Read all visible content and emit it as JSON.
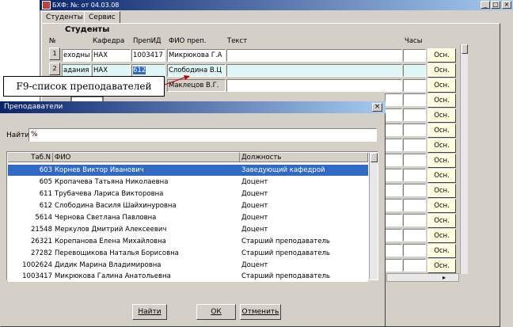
{
  "window": {
    "title": "БХФ: №: от 04.03.08"
  },
  "tabs": [
    {
      "label": "Студенты"
    },
    {
      "label": "Сервис"
    }
  ],
  "block": {
    "title": "Студенты",
    "headers": {
      "num": "№",
      "kafedra": "Кафедра",
      "prepid": "ПрепИД",
      "fio": "ФИО преп.",
      "text": "Текст",
      "hours": "Часы"
    },
    "rows": [
      {
        "num": "1",
        "left": "еходны",
        "kafedra": "НАХ",
        "prepid": "1003417",
        "fio": "Микрюкова Г.А",
        "osn": "Осн."
      },
      {
        "num": "2",
        "left": "адания",
        "kafedra": "НАХ",
        "prepid": "612",
        "fio": "Слободина В.Ц",
        "osn": "Осн."
      },
      {
        "num": "",
        "left": "",
        "kafedra": "",
        "prepid": "",
        "fio": "Маклецов В.Г.",
        "osn": "Осн."
      },
      {
        "num": "",
        "left": "",
        "kafedra": "",
        "prepid": "",
        "fio": "",
        "osn": "Осн."
      },
      {
        "num": "",
        "left": "",
        "kafedra": "",
        "prepid": "",
        "fio": "",
        "osn": "Осн."
      },
      {
        "num": "",
        "left": "",
        "kafedra": "",
        "prepid": "",
        "fio": "",
        "osn": "Осн."
      },
      {
        "num": "",
        "left": "",
        "kafedra": "",
        "prepid": "",
        "fio": "",
        "osn": "Осн."
      },
      {
        "num": "",
        "left": "",
        "kafedra": "",
        "prepid": "",
        "fio": "",
        "osn": "Осн."
      },
      {
        "num": "",
        "left": "",
        "kafedra": "",
        "prepid": "",
        "fio": "",
        "osn": "Осн."
      },
      {
        "num": "",
        "left": "",
        "kafedra": "",
        "prepid": "",
        "fio": "",
        "osn": "Осн."
      },
      {
        "num": "",
        "left": "",
        "kafedra": "",
        "prepid": "",
        "fio": "",
        "osn": "Осн."
      },
      {
        "num": "",
        "left": "",
        "kafedra": "",
        "prepid": "",
        "fio": "",
        "osn": "Осн."
      },
      {
        "num": "",
        "left": "",
        "kafedra": "",
        "prepid": "",
        "fio": "",
        "osn": "Осн."
      },
      {
        "num": "",
        "left": "",
        "kafedra": "",
        "prepid": "",
        "fio": "",
        "osn": "Осн."
      },
      {
        "num": "",
        "left": "",
        "kafedra": "",
        "prepid": "",
        "fio": "",
        "osn": "Осн."
      }
    ]
  },
  "callout": {
    "text": "F9-список преподавателей"
  },
  "dialog": {
    "title": "Преподаватели",
    "close_glyph": "×",
    "find_label": "Найти",
    "find_value": "%",
    "columns": {
      "tab": "Таб.N",
      "fio": "ФИО",
      "position": "Должность"
    },
    "rows": [
      {
        "tab": "603",
        "fio": "Корнев Виктор Иванович",
        "position": "Заведующий кафедрой",
        "selected": true
      },
      {
        "tab": "605",
        "fio": "Кропачева Татьяна Николаевна",
        "position": "Доцент"
      },
      {
        "tab": "611",
        "fio": "Трубачева Лариса Викторовна",
        "position": "Доцент"
      },
      {
        "tab": "612",
        "fio": "Слободина Василя Шайхинуровна",
        "position": "Доцент"
      },
      {
        "tab": "5614",
        "fio": "Чернова Светлана Павловна",
        "position": "Доцент"
      },
      {
        "tab": "21548",
        "fio": "Меркулов Дмитрий Алексеевич",
        "position": "Доцент"
      },
      {
        "tab": "26321",
        "fio": "Корепанова Елена Михайловна",
        "position": "Старший преподаватель"
      },
      {
        "tab": "27282",
        "fio": "Перевощикова Наталья Борисовна",
        "position": "Старший преподаватель"
      },
      {
        "tab": "1002624",
        "fio": "Дидик Марина Владимировна",
        "position": "Доцент"
      },
      {
        "tab": "1003417",
        "fio": "Микрюкова Галина Анатольевна",
        "position": "Старший преподаватель"
      }
    ],
    "buttons": {
      "find": "Найти",
      "ok": "ОК",
      "cancel": "Отменить"
    }
  },
  "icons": {
    "scroll_left": "◂",
    "scroll_right": "▸"
  }
}
